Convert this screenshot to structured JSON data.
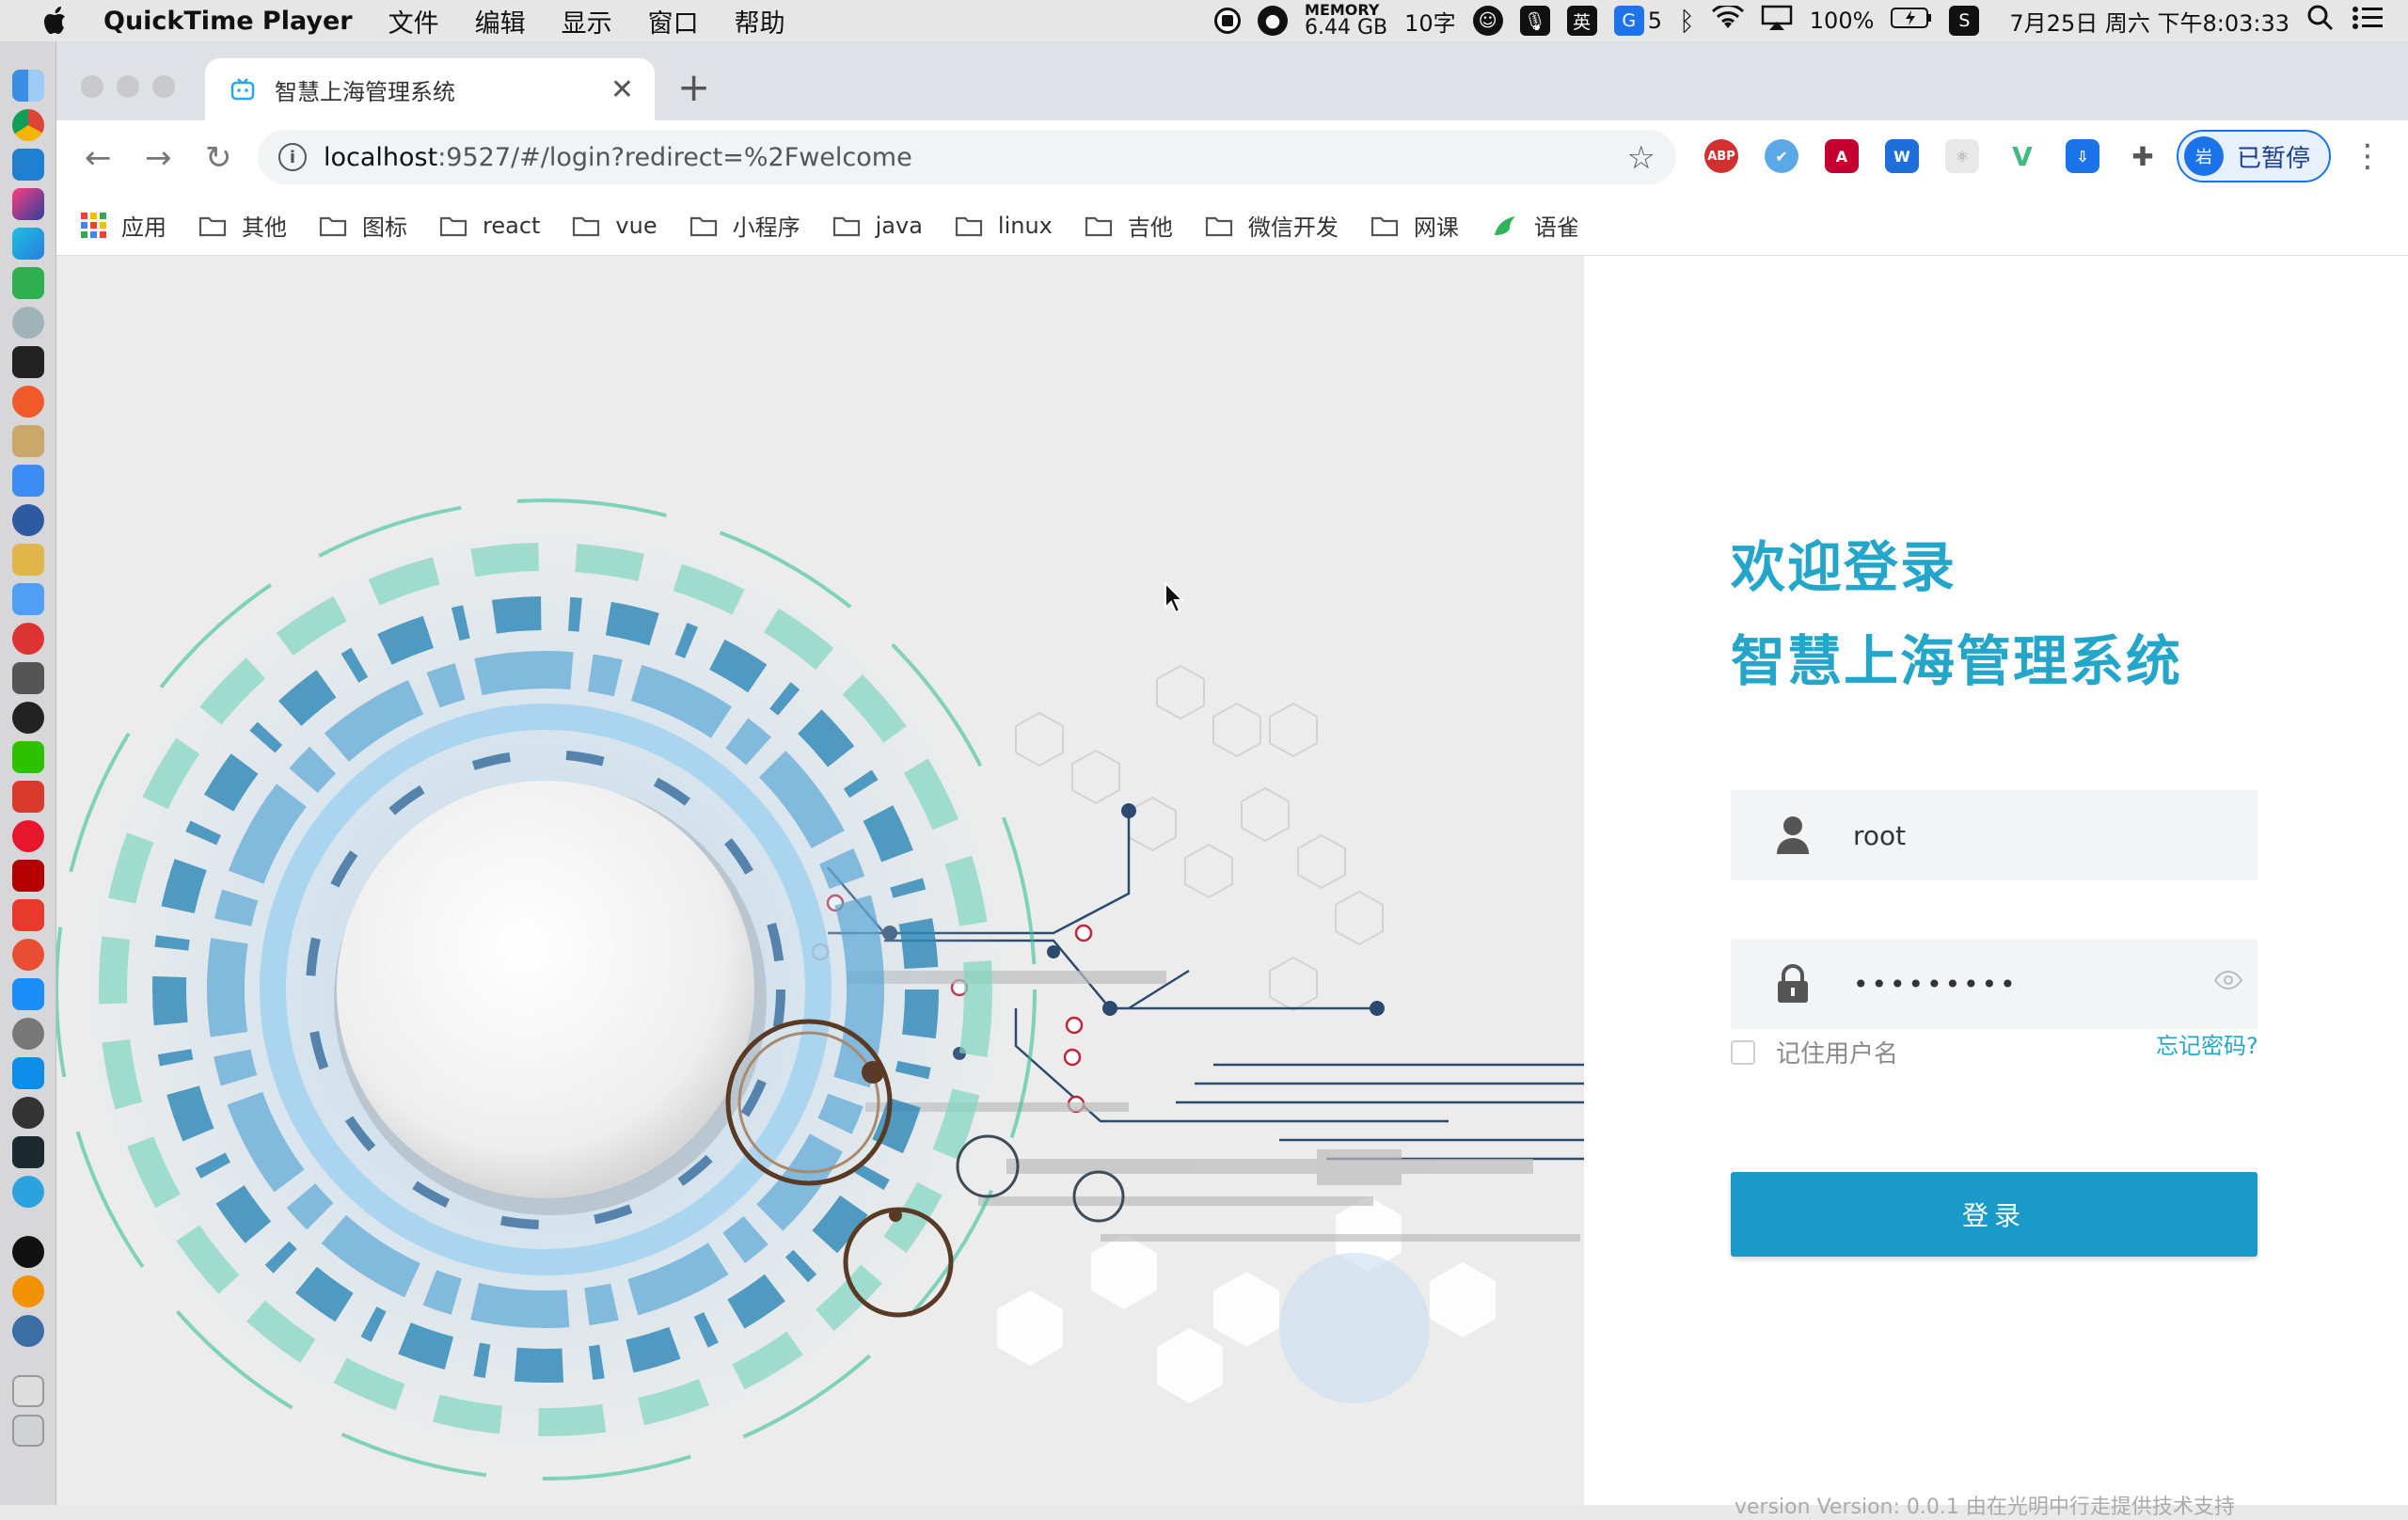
{
  "menubar": {
    "app_name": "QuickTime Player",
    "menus": [
      "文件",
      "编辑",
      "显示",
      "窗口",
      "帮助"
    ],
    "memory_label": "MEMORY",
    "memory_value": "6.44 GB",
    "word_count": "10字",
    "input_lang": "英",
    "notif_count": "5",
    "battery": "100%",
    "datetime": "7月25日 周六 下午8:03:33"
  },
  "browser": {
    "tab_title": "智慧上海管理系统",
    "url_host": "localhost",
    "url_path": ":9527/#/login?redirect=%2Fwelcome",
    "extension_abp": "ABP",
    "extension_w": "W",
    "extension_v": "V",
    "profile_avatar": "岩",
    "profile_status": "已暂停",
    "bookmarks": [
      "应用",
      "其他",
      "图标",
      "react",
      "vue",
      "小程序",
      "java",
      "linux",
      "吉他",
      "微信开发",
      "网课",
      "语雀"
    ]
  },
  "login": {
    "welcome": "欢迎登录",
    "system_name": "智慧上海管理系统",
    "username": "root",
    "password_mask": "•••••••••",
    "remember_label": "记住用户名",
    "forgot_label": "忘记密码?",
    "submit_label": "登录",
    "version_text": "version Version: 0.0.1 由在光明中行走提供技术支持"
  },
  "colors": {
    "accent": "#23a6c9",
    "button": "#199ac9"
  }
}
